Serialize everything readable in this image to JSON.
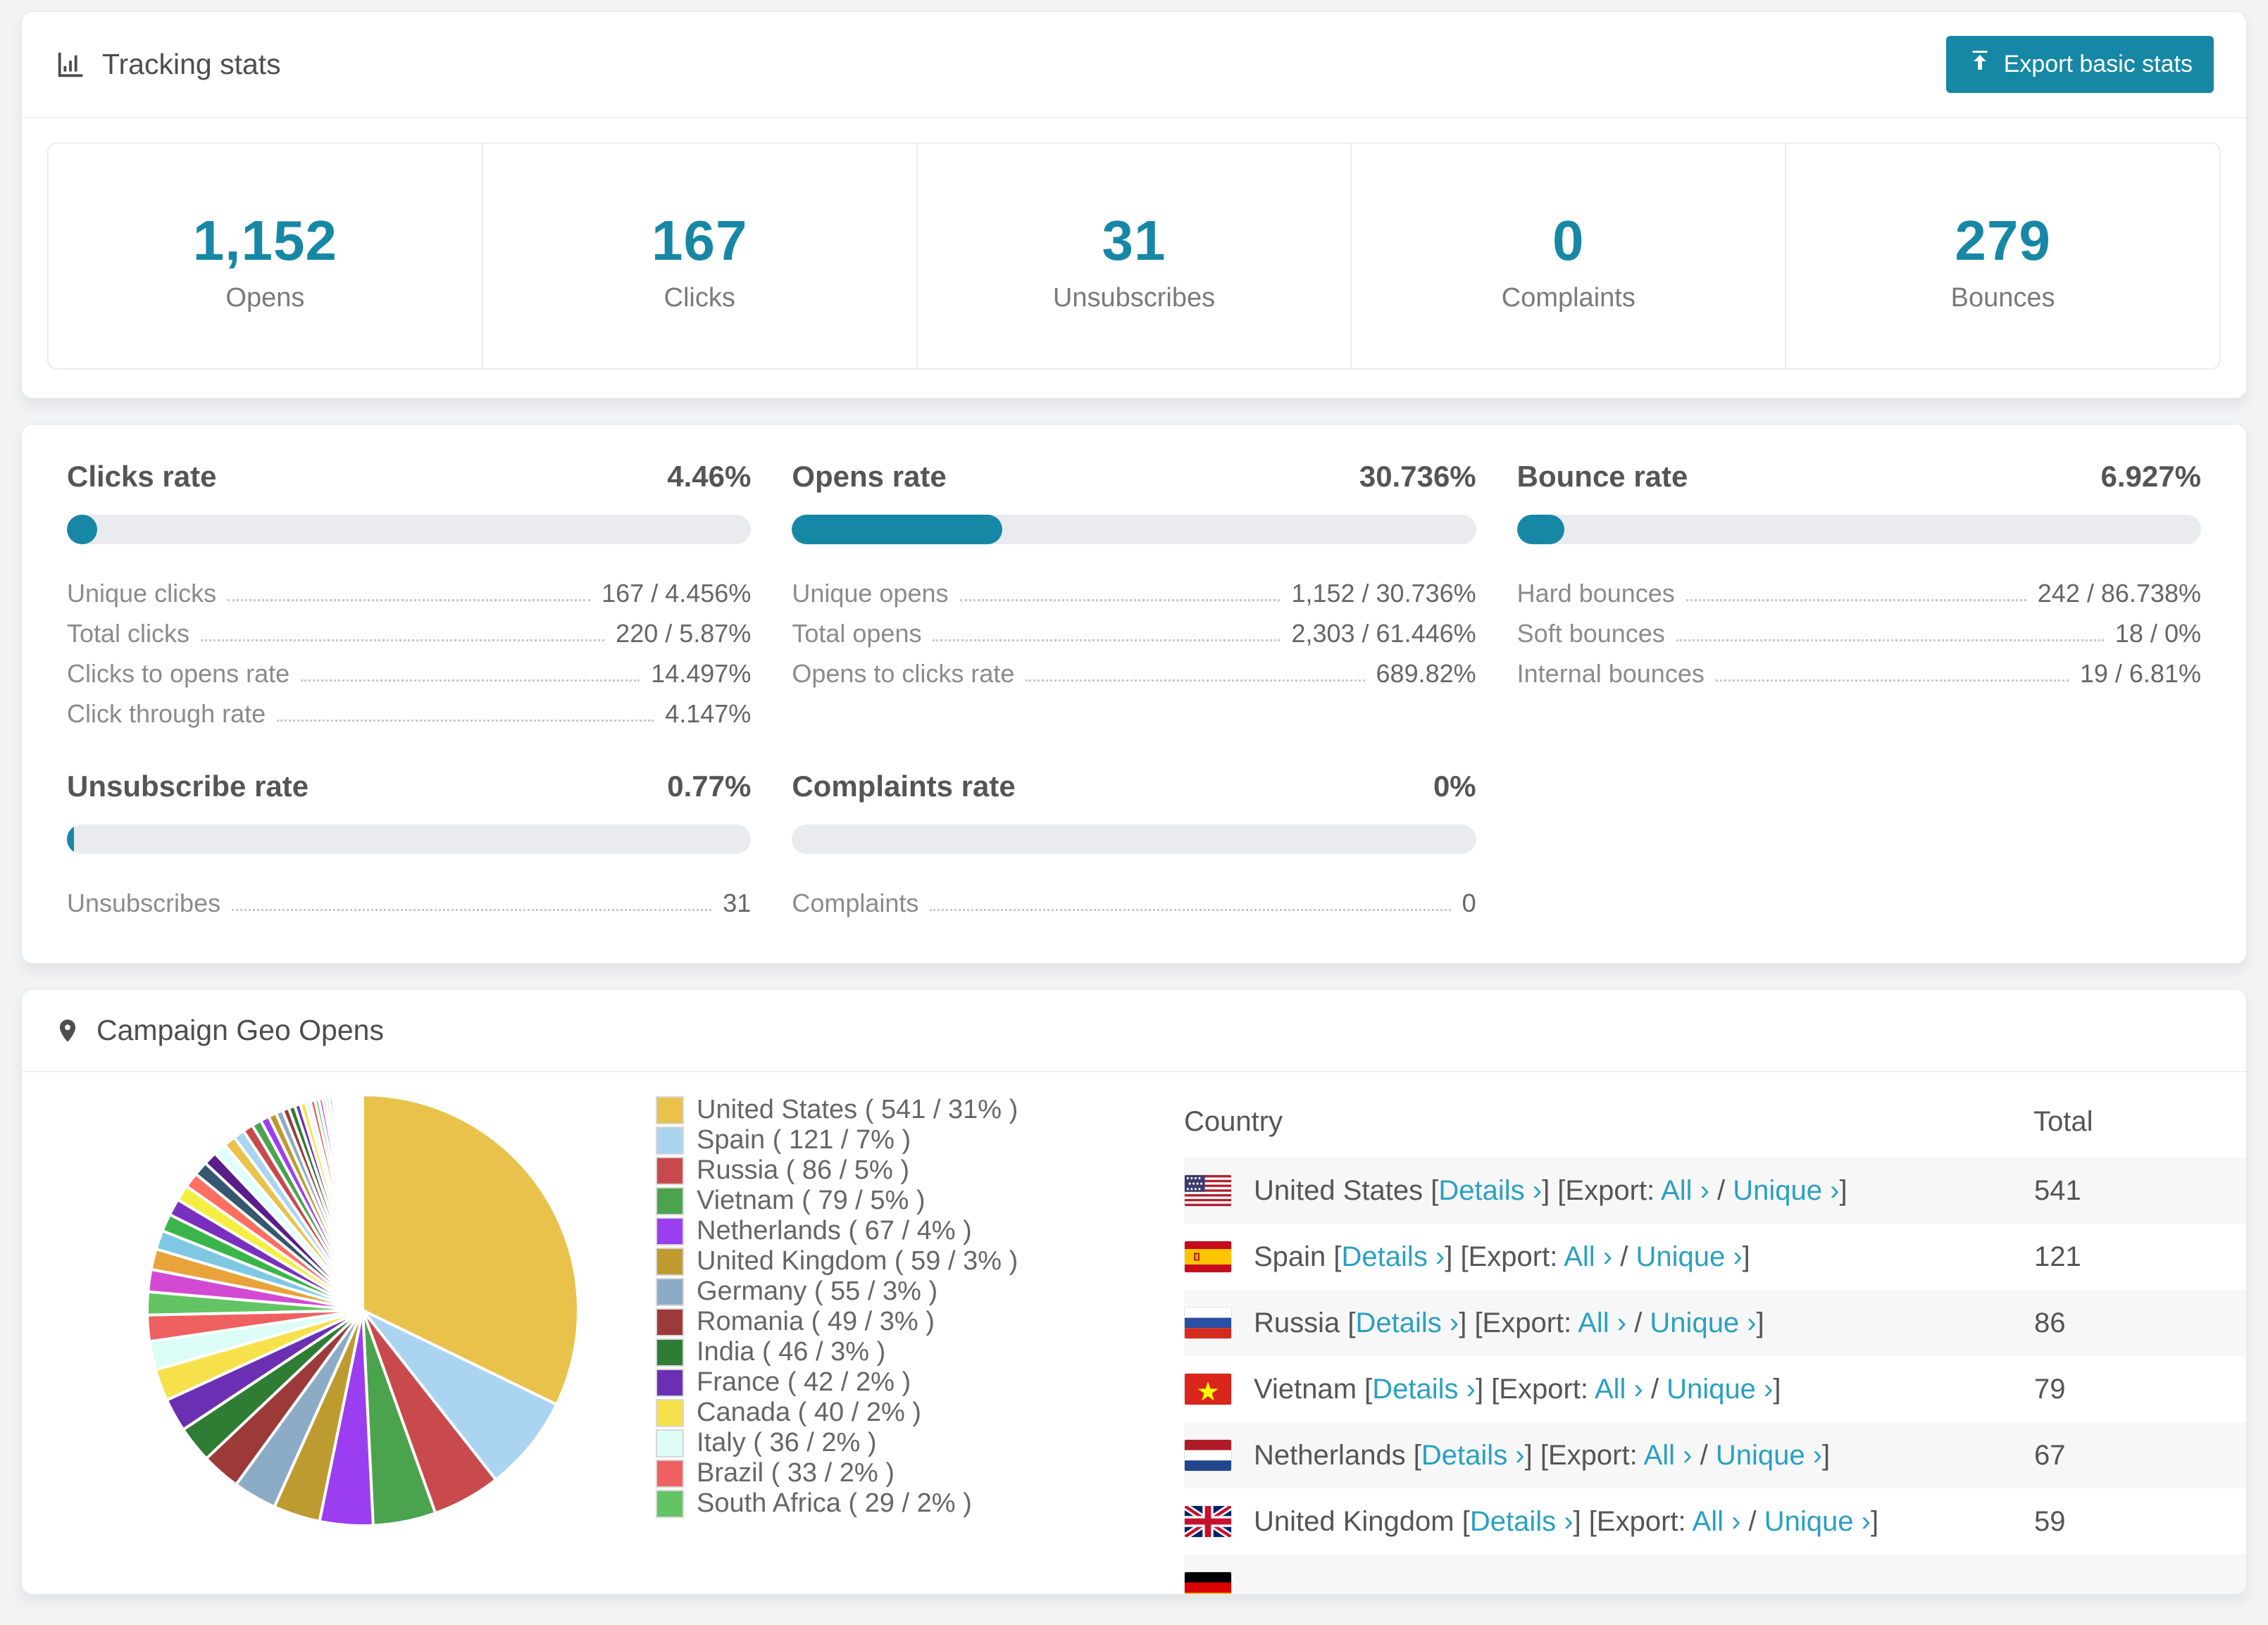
{
  "colors": {
    "accent": "#1787a6",
    "link": "#2aa0c2",
    "bar_track": "#e9ebee"
  },
  "tracking_stats": {
    "title": "Tracking stats",
    "title_icon": "bar-chart-icon",
    "export_button": "Export basic stats",
    "summary": [
      {
        "value": "1,152",
        "label": "Opens"
      },
      {
        "value": "167",
        "label": "Clicks"
      },
      {
        "value": "31",
        "label": "Unsubscribes"
      },
      {
        "value": "0",
        "label": "Complaints"
      },
      {
        "value": "279",
        "label": "Bounces"
      }
    ]
  },
  "rates": [
    {
      "title": "Clicks rate",
      "value": "4.46%",
      "percent": 4.46,
      "rows": [
        [
          "Unique clicks",
          "167 / 4.456%"
        ],
        [
          "Total clicks",
          "220 / 5.87%"
        ],
        [
          "Clicks to opens rate",
          "14.497%"
        ],
        [
          "Click through rate",
          "4.147%"
        ]
      ]
    },
    {
      "title": "Opens rate",
      "value": "30.736%",
      "percent": 30.736,
      "rows": [
        [
          "Unique opens",
          "1,152 / 30.736%"
        ],
        [
          "Total opens",
          "2,303 / 61.446%"
        ],
        [
          "Opens to clicks rate",
          "689.82%"
        ]
      ]
    },
    {
      "title": "Bounce rate",
      "value": "6.927%",
      "percent": 6.927,
      "rows": [
        [
          "Hard bounces",
          "242 / 86.738%"
        ],
        [
          "Soft bounces",
          "18 / 0%"
        ],
        [
          "Internal bounces",
          "19 / 6.81%"
        ]
      ]
    },
    {
      "title": "Unsubscribe rate",
      "value": "0.77%",
      "percent": 0.77,
      "rows": [
        [
          "Unsubscribes",
          "31"
        ]
      ]
    },
    {
      "title": "Complaints rate",
      "value": "0%",
      "percent": 0,
      "rows": [
        [
          "Complaints",
          "0"
        ]
      ]
    }
  ],
  "geo": {
    "title": "Campaign Geo Opens",
    "title_icon": "map-marker-icon",
    "table": {
      "columns": [
        "Country",
        "Total"
      ],
      "link_labels": {
        "details": "Details ›",
        "export_prefix": "Export:",
        "all": "All ›",
        "unique": "Unique ›"
      },
      "rows": [
        {
          "country": "United States",
          "flag": "us",
          "total": "541"
        },
        {
          "country": "Spain",
          "flag": "es",
          "total": "121"
        },
        {
          "country": "Russia",
          "flag": "ru",
          "total": "86"
        },
        {
          "country": "Vietnam",
          "flag": "vn",
          "total": "79"
        },
        {
          "country": "Netherlands",
          "flag": "nl",
          "total": "67"
        },
        {
          "country": "United Kingdom",
          "flag": "gb",
          "total": "59"
        },
        {
          "country": "",
          "flag": "de",
          "total": ""
        }
      ]
    }
  },
  "chart_data": {
    "type": "pie",
    "title": "Campaign Geo Opens",
    "legend_position": "right",
    "labels": [
      "United States",
      "Spain",
      "Russia",
      "Vietnam",
      "Netherlands",
      "United Kingdom",
      "Germany",
      "Romania",
      "India",
      "France",
      "Canada",
      "Italy",
      "Brazil",
      "South Africa"
    ],
    "values": [
      541,
      121,
      86,
      79,
      67,
      59,
      55,
      49,
      46,
      42,
      40,
      36,
      33,
      29
    ],
    "percents": [
      31,
      7,
      5,
      5,
      4,
      3,
      3,
      3,
      3,
      2,
      2,
      2,
      2,
      2
    ],
    "legend_texts": [
      "United States ( 541 / 31% )",
      "Spain ( 121 / 7% )",
      "Russia ( 86 / 5% )",
      "Vietnam ( 79 / 5% )",
      "Netherlands ( 67 / 4% )",
      "United Kingdom ( 59 / 3% )",
      "Germany ( 55 / 3% )",
      "Romania ( 49 / 3% )",
      "India ( 46 / 3% )",
      "France ( 42 / 2% )",
      "Canada ( 40 / 2% )",
      "Italy ( 36 / 2% )",
      "Brazil ( 33 / 2% )",
      "South Africa ( 29 / 2% )"
    ],
    "colors": [
      "#e8c24a",
      "#abd4f1",
      "#c94a4c",
      "#4ba34e",
      "#9b3ef0",
      "#bd9b30",
      "#8cabc6",
      "#9c3a3a",
      "#2f7c35",
      "#6b2fb3",
      "#f7e14b",
      "#dcfdf6",
      "#ef6060",
      "#62c462"
    ],
    "tail_values": [
      28,
      26,
      24,
      22,
      21,
      20,
      19,
      18,
      17,
      16,
      15,
      14,
      13,
      12,
      11,
      10,
      9,
      8,
      8,
      7,
      7,
      6,
      6,
      5,
      5,
      4,
      4,
      4,
      3,
      3,
      3,
      3,
      2,
      2,
      2,
      2,
      2,
      2,
      1,
      1,
      1,
      1,
      1,
      1,
      1,
      1,
      0.8,
      0.7,
      0.6,
      0.5,
      0.5,
      0.4,
      0.4,
      0.3,
      0.3,
      0.2,
      0.2,
      0.2,
      0.1,
      0.1,
      0.1,
      0.1,
      0.1,
      0.1,
      0.1,
      0.1
    ],
    "tail_note": "unlabeled small slices (other countries)"
  }
}
